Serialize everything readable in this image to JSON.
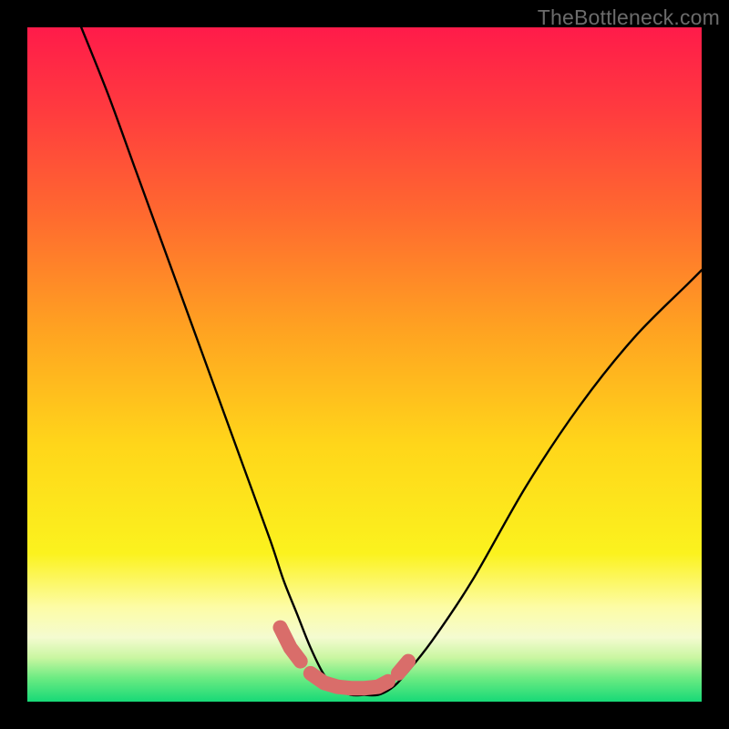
{
  "watermark": "TheBottleneck.com",
  "colors": {
    "black": "#000000",
    "curve": "#000000",
    "marker": "#d96d6a",
    "gradient_stops": [
      {
        "offset": 0.0,
        "color": "#ff1b4a"
      },
      {
        "offset": 0.12,
        "color": "#ff3a3f"
      },
      {
        "offset": 0.28,
        "color": "#ff6a2f"
      },
      {
        "offset": 0.45,
        "color": "#ffa321"
      },
      {
        "offset": 0.62,
        "color": "#ffd61a"
      },
      {
        "offset": 0.78,
        "color": "#fbf21e"
      },
      {
        "offset": 0.86,
        "color": "#fdfca6"
      },
      {
        "offset": 0.905,
        "color": "#f4fbd0"
      },
      {
        "offset": 0.935,
        "color": "#c9f6a1"
      },
      {
        "offset": 0.965,
        "color": "#6ceb82"
      },
      {
        "offset": 1.0,
        "color": "#17d977"
      }
    ]
  },
  "chart_data": {
    "type": "line",
    "title": "",
    "xlabel": "",
    "ylabel": "",
    "xlim": [
      0,
      100
    ],
    "ylim": [
      0,
      100
    ],
    "grid": false,
    "series": [
      {
        "name": "bottleneck-curve",
        "x": [
          8,
          12,
          16,
          20,
          24,
          28,
          32,
          36,
          38,
          40,
          42,
          44,
          46,
          48,
          50,
          52,
          54,
          56,
          60,
          66,
          74,
          82,
          90,
          98,
          100
        ],
        "values": [
          100,
          90,
          79,
          68,
          57,
          46,
          35,
          24,
          18,
          13,
          8,
          4,
          2,
          1,
          1,
          1,
          2,
          4,
          9,
          18,
          32,
          44,
          54,
          62,
          64
        ]
      }
    ],
    "markers": {
      "name": "highlight-segments",
      "x": [
        37.5,
        39.0,
        40.5,
        42.0,
        44.0,
        46.0,
        48.0,
        50.0,
        52.0,
        53.5,
        55.0,
        56.5
      ],
      "values": [
        11.0,
        8.0,
        6.0,
        4.2,
        2.8,
        2.2,
        2.0,
        2.0,
        2.2,
        3.0,
        4.2,
        6.0
      ]
    }
  }
}
